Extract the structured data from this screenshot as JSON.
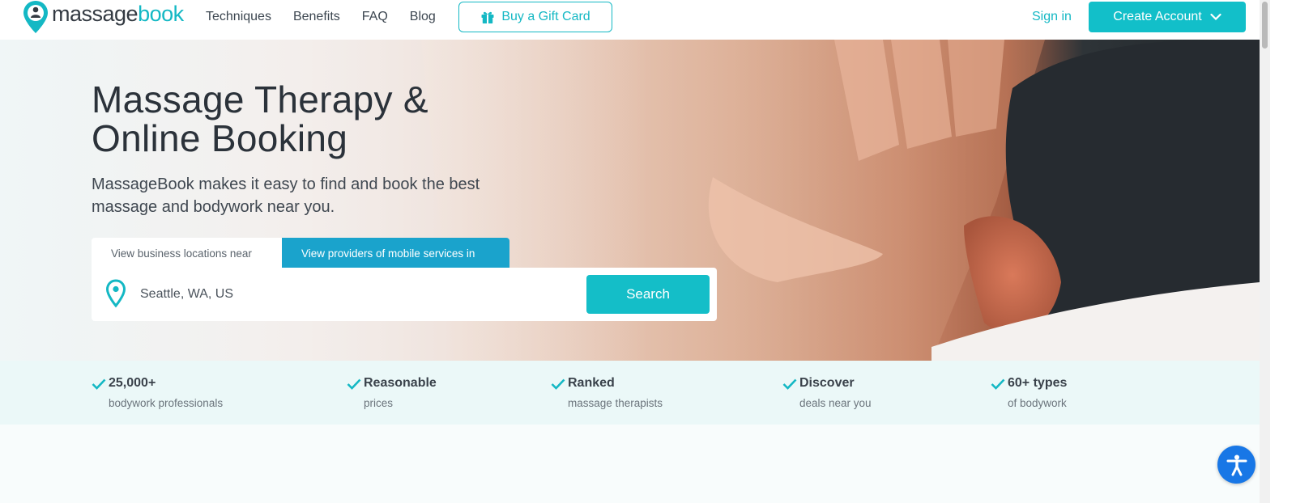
{
  "brand": {
    "part1": "massage",
    "part2": "book",
    "accent": "#14b8c4"
  },
  "nav": {
    "links": [
      "Techniques",
      "Benefits",
      "FAQ",
      "Blog"
    ],
    "gift_label": "Buy a Gift Card",
    "signin_label": "Sign in",
    "create_label": "Create Account"
  },
  "hero": {
    "title": "Massage Therapy & Online Booking",
    "subtitle": "MassageBook makes it easy to find and book the best massage and bodywork near you.",
    "tabs": [
      {
        "label": "View business locations near",
        "active": false
      },
      {
        "label": "View providers of mobile services in",
        "active": true
      }
    ],
    "location_value": "Seattle, WA, US",
    "search_label": "Search"
  },
  "features": [
    {
      "title": "25,000+",
      "subtitle": "bodywork professionals"
    },
    {
      "title": "Reasonable",
      "subtitle": "prices"
    },
    {
      "title": "Ranked",
      "subtitle": "massage therapists"
    },
    {
      "title": "Discover",
      "subtitle": "deals near you"
    },
    {
      "title": "60+ types",
      "subtitle": "of bodywork"
    }
  ],
  "icons": {
    "logo": "map-pin-person-icon",
    "gift": "gift-icon",
    "create_dropdown": "chevron-down-icon",
    "location": "map-pin-icon",
    "feature_check": "checkmark-icon",
    "accessibility": "accessibility-person-icon"
  }
}
